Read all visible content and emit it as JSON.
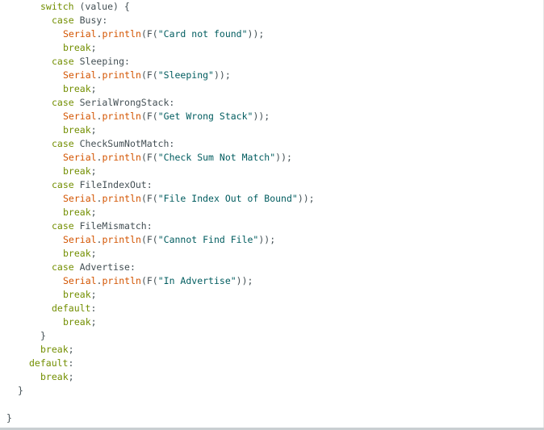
{
  "colors": {
    "background": "#ffffff",
    "plain_text": "#434f54",
    "keyword": "#728e00",
    "function": "#d35400",
    "string": "#005c5f"
  },
  "code_lines": [
    {
      "indent": 3,
      "tokens": [
        {
          "t": "switch",
          "c": "kw"
        },
        {
          "t": " (value) {",
          "c": "plain"
        }
      ]
    },
    {
      "indent": 4,
      "tokens": [
        {
          "t": "case",
          "c": "kw"
        },
        {
          "t": " Busy:",
          "c": "plain"
        }
      ]
    },
    {
      "indent": 5,
      "tokens": [
        {
          "t": "Serial",
          "c": "fn"
        },
        {
          "t": ".",
          "c": "plain"
        },
        {
          "t": "println",
          "c": "fn"
        },
        {
          "t": "(F(",
          "c": "plain"
        },
        {
          "t": "\"Card not found\"",
          "c": "str"
        },
        {
          "t": "));",
          "c": "plain"
        }
      ]
    },
    {
      "indent": 5,
      "tokens": [
        {
          "t": "break",
          "c": "kw"
        },
        {
          "t": ";",
          "c": "plain"
        }
      ]
    },
    {
      "indent": 4,
      "tokens": [
        {
          "t": "case",
          "c": "kw"
        },
        {
          "t": " Sleeping:",
          "c": "plain"
        }
      ]
    },
    {
      "indent": 5,
      "tokens": [
        {
          "t": "Serial",
          "c": "fn"
        },
        {
          "t": ".",
          "c": "plain"
        },
        {
          "t": "println",
          "c": "fn"
        },
        {
          "t": "(F(",
          "c": "plain"
        },
        {
          "t": "\"Sleeping\"",
          "c": "str"
        },
        {
          "t": "));",
          "c": "plain"
        }
      ]
    },
    {
      "indent": 5,
      "tokens": [
        {
          "t": "break",
          "c": "kw"
        },
        {
          "t": ";",
          "c": "plain"
        }
      ]
    },
    {
      "indent": 4,
      "tokens": [
        {
          "t": "case",
          "c": "kw"
        },
        {
          "t": " SerialWrongStack:",
          "c": "plain"
        }
      ]
    },
    {
      "indent": 5,
      "tokens": [
        {
          "t": "Serial",
          "c": "fn"
        },
        {
          "t": ".",
          "c": "plain"
        },
        {
          "t": "println",
          "c": "fn"
        },
        {
          "t": "(F(",
          "c": "plain"
        },
        {
          "t": "\"Get Wrong Stack\"",
          "c": "str"
        },
        {
          "t": "));",
          "c": "plain"
        }
      ]
    },
    {
      "indent": 5,
      "tokens": [
        {
          "t": "break",
          "c": "kw"
        },
        {
          "t": ";",
          "c": "plain"
        }
      ]
    },
    {
      "indent": 4,
      "tokens": [
        {
          "t": "case",
          "c": "kw"
        },
        {
          "t": " CheckSumNotMatch:",
          "c": "plain"
        }
      ]
    },
    {
      "indent": 5,
      "tokens": [
        {
          "t": "Serial",
          "c": "fn"
        },
        {
          "t": ".",
          "c": "plain"
        },
        {
          "t": "println",
          "c": "fn"
        },
        {
          "t": "(F(",
          "c": "plain"
        },
        {
          "t": "\"Check Sum Not Match\"",
          "c": "str"
        },
        {
          "t": "));",
          "c": "plain"
        }
      ]
    },
    {
      "indent": 5,
      "tokens": [
        {
          "t": "break",
          "c": "kw"
        },
        {
          "t": ";",
          "c": "plain"
        }
      ]
    },
    {
      "indent": 4,
      "tokens": [
        {
          "t": "case",
          "c": "kw"
        },
        {
          "t": " FileIndexOut:",
          "c": "plain"
        }
      ]
    },
    {
      "indent": 5,
      "tokens": [
        {
          "t": "Serial",
          "c": "fn"
        },
        {
          "t": ".",
          "c": "plain"
        },
        {
          "t": "println",
          "c": "fn"
        },
        {
          "t": "(F(",
          "c": "plain"
        },
        {
          "t": "\"File Index Out of Bound\"",
          "c": "str"
        },
        {
          "t": "));",
          "c": "plain"
        }
      ]
    },
    {
      "indent": 5,
      "tokens": [
        {
          "t": "break",
          "c": "kw"
        },
        {
          "t": ";",
          "c": "plain"
        }
      ]
    },
    {
      "indent": 4,
      "tokens": [
        {
          "t": "case",
          "c": "kw"
        },
        {
          "t": " FileMismatch:",
          "c": "plain"
        }
      ]
    },
    {
      "indent": 5,
      "tokens": [
        {
          "t": "Serial",
          "c": "fn"
        },
        {
          "t": ".",
          "c": "plain"
        },
        {
          "t": "println",
          "c": "fn"
        },
        {
          "t": "(F(",
          "c": "plain"
        },
        {
          "t": "\"Cannot Find File\"",
          "c": "str"
        },
        {
          "t": "));",
          "c": "plain"
        }
      ]
    },
    {
      "indent": 5,
      "tokens": [
        {
          "t": "break",
          "c": "kw"
        },
        {
          "t": ";",
          "c": "plain"
        }
      ]
    },
    {
      "indent": 4,
      "tokens": [
        {
          "t": "case",
          "c": "kw"
        },
        {
          "t": " Advertise:",
          "c": "plain"
        }
      ]
    },
    {
      "indent": 5,
      "tokens": [
        {
          "t": "Serial",
          "c": "fn"
        },
        {
          "t": ".",
          "c": "plain"
        },
        {
          "t": "println",
          "c": "fn"
        },
        {
          "t": "(F(",
          "c": "plain"
        },
        {
          "t": "\"In Advertise\"",
          "c": "str"
        },
        {
          "t": "));",
          "c": "plain"
        }
      ]
    },
    {
      "indent": 5,
      "tokens": [
        {
          "t": "break",
          "c": "kw"
        },
        {
          "t": ";",
          "c": "plain"
        }
      ]
    },
    {
      "indent": 4,
      "tokens": [
        {
          "t": "default",
          "c": "kw"
        },
        {
          "t": ":",
          "c": "plain"
        }
      ]
    },
    {
      "indent": 5,
      "tokens": [
        {
          "t": "break",
          "c": "kw"
        },
        {
          "t": ";",
          "c": "plain"
        }
      ]
    },
    {
      "indent": 3,
      "tokens": []
    },
    {
      "indent": 3,
      "tokens": [
        {
          "t": "}",
          "c": "plain"
        }
      ]
    },
    {
      "indent": 3,
      "tokens": [
        {
          "t": "break",
          "c": "kw"
        },
        {
          "t": ";",
          "c": "plain"
        }
      ]
    },
    {
      "indent": 2,
      "tokens": [
        {
          "t": "default",
          "c": "kw"
        },
        {
          "t": ":",
          "c": "plain"
        }
      ]
    },
    {
      "indent": 3,
      "tokens": [
        {
          "t": "break",
          "c": "kw"
        },
        {
          "t": ";",
          "c": "plain"
        }
      ]
    },
    {
      "indent": 1,
      "tokens": [
        {
          "t": "}",
          "c": "plain"
        }
      ]
    },
    {
      "indent": 0,
      "tokens": []
    },
    {
      "indent": 0,
      "tokens": [
        {
          "t": "}",
          "c": "plain"
        }
      ]
    }
  ]
}
